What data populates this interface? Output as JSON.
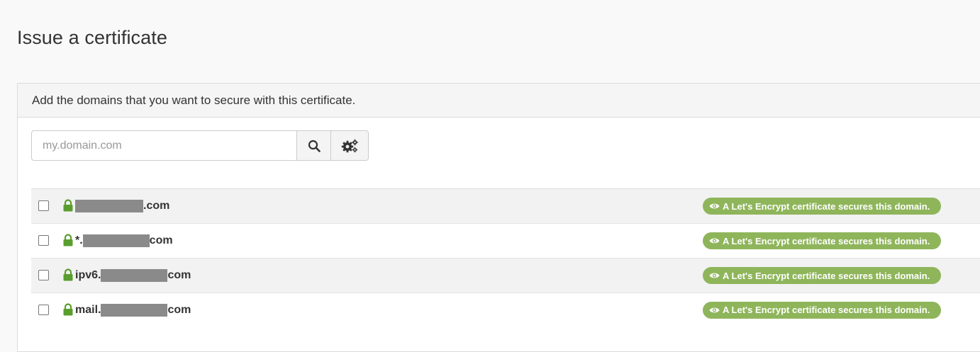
{
  "page": {
    "title": "Issue a certificate"
  },
  "panel": {
    "heading": "Add the domains that you want to secure with this certificate."
  },
  "search": {
    "placeholder": "my.domain.com",
    "value": "",
    "search_icon": "search-icon",
    "options_icon": "gears-icon"
  },
  "status_color": "#8fb55b",
  "domains": [
    {
      "prefix": "",
      "suffix": ".com",
      "status": "A Let's Encrypt certificate secures this domain.",
      "checked": false
    },
    {
      "prefix": "*.",
      "suffix": "com",
      "status": "A Let's Encrypt certificate secures this domain.",
      "checked": false
    },
    {
      "prefix": "ipv6.",
      "suffix": "com",
      "status": "A Let's Encrypt certificate secures this domain.",
      "checked": false
    },
    {
      "prefix": "mail.",
      "suffix": "com",
      "status": "A Let's Encrypt certificate secures this domain.",
      "checked": false
    }
  ]
}
